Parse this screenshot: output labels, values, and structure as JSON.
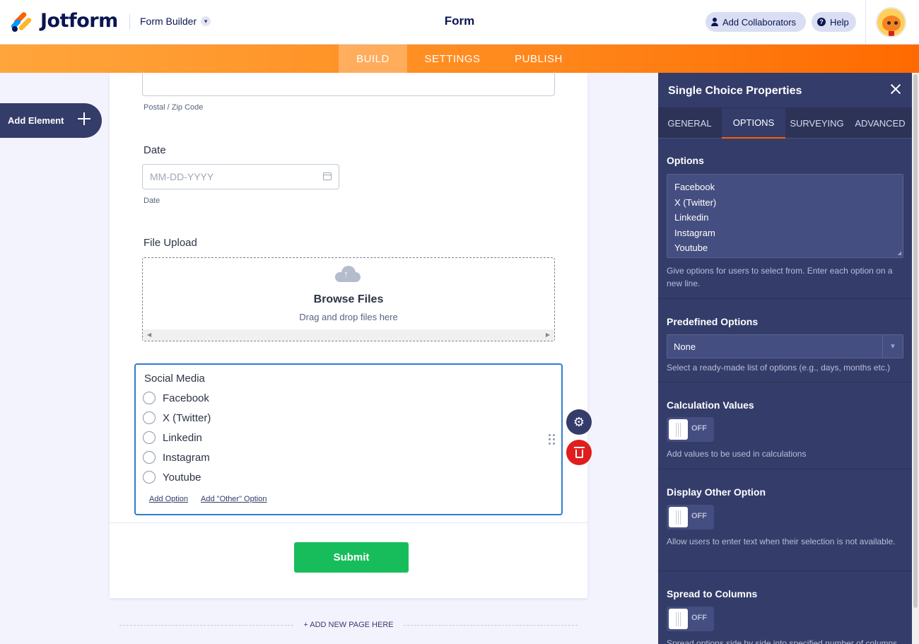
{
  "header": {
    "brand": "Jotform",
    "builder_label": "Form Builder",
    "title": "Form",
    "collaborators_label": "Add Collaborators",
    "help_label": "Help"
  },
  "nav": {
    "tabs": [
      "BUILD",
      "SETTINGS",
      "PUBLISH"
    ],
    "active": "BUILD"
  },
  "sidebar": {
    "add_element_label": "Add Element"
  },
  "form": {
    "zip_sublabel": "Postal / Zip Code",
    "date": {
      "label": "Date",
      "placeholder": "MM-DD-YYYY",
      "sublabel": "Date"
    },
    "file_upload": {
      "label": "File Upload",
      "browse": "Browse Files",
      "drag": "Drag and drop files here"
    },
    "social": {
      "title": "Social Media",
      "options": [
        "Facebook",
        "X (Twitter)",
        "Linkedin",
        "Instagram",
        "Youtube"
      ],
      "add_option": "Add Option",
      "add_other": "Add \"Other\" Option"
    },
    "submit_label": "Submit",
    "add_page_label": "+ ADD NEW PAGE HERE"
  },
  "panel": {
    "title": "Single Choice Properties",
    "tabs": [
      "GENERAL",
      "OPTIONS",
      "SURVEYING",
      "ADVANCED"
    ],
    "active_tab": "OPTIONS",
    "options": {
      "title": "Options",
      "values": [
        "Facebook",
        "X (Twitter)",
        "Linkedin",
        "Instagram",
        "Youtube"
      ],
      "desc": "Give options for users to select from. Enter each option on a new line."
    },
    "predefined": {
      "title": "Predefined Options",
      "value": "None",
      "desc": "Select a ready-made list of options (e.g., days, months etc.)"
    },
    "calculation": {
      "title": "Calculation Values",
      "state": "OFF",
      "desc": "Add values to be used in calculations"
    },
    "other": {
      "title": "Display Other Option",
      "state": "OFF",
      "desc": "Allow users to enter text when their selection is not available."
    },
    "spread": {
      "title": "Spread to Columns",
      "state": "OFF",
      "desc": "Spread options side by side into specified number of columns."
    }
  },
  "colors": {
    "accent": "#ff6100",
    "panel_bg": "#343c6a",
    "submit": "#18bd5b",
    "selected_border": "#2f7dd1",
    "delete": "#e01e1e"
  }
}
